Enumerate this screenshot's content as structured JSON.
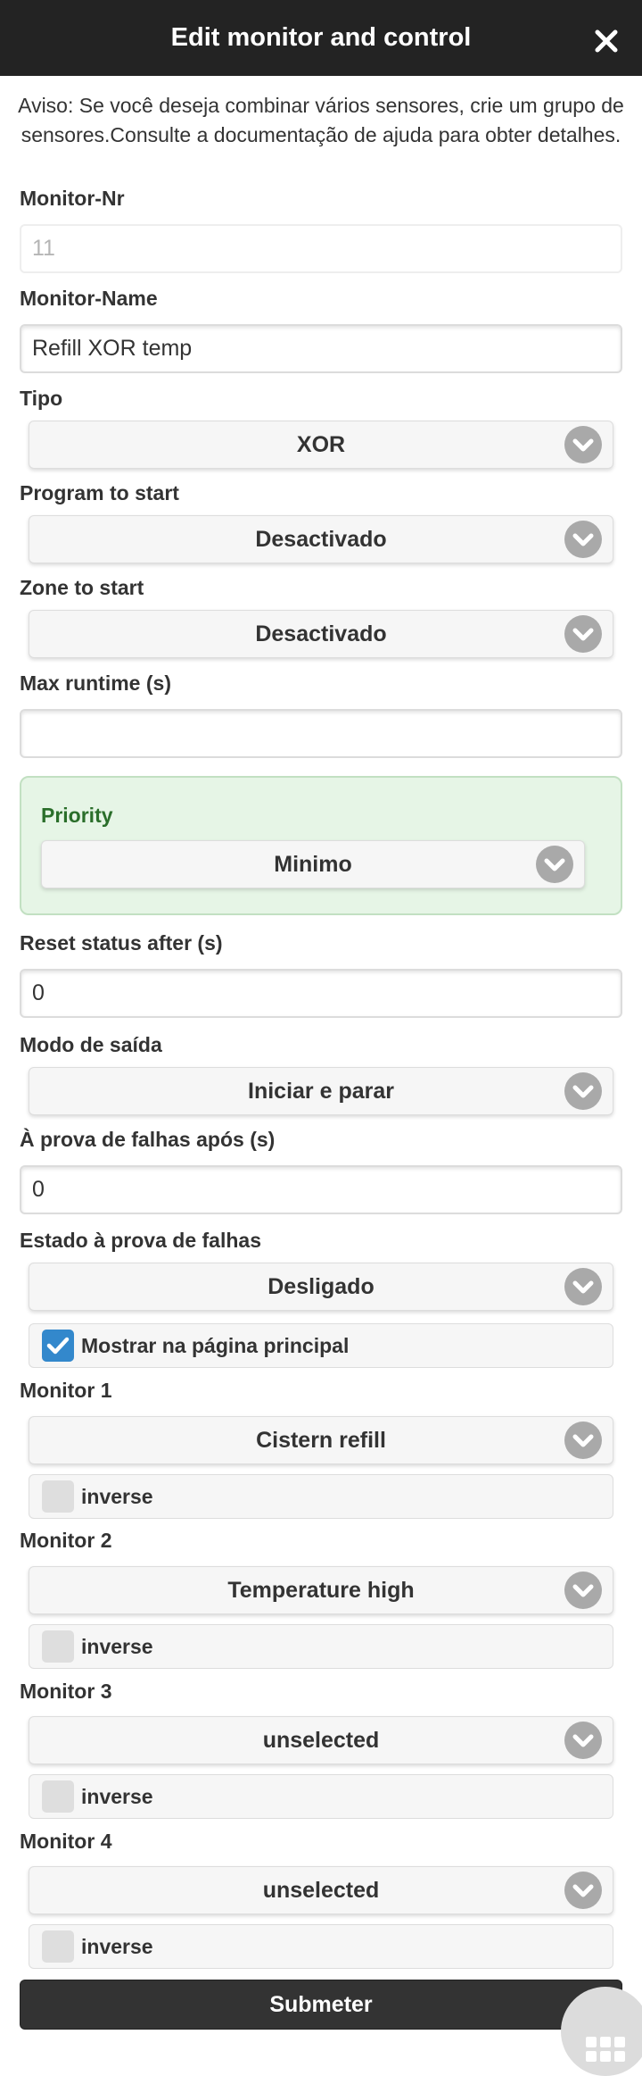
{
  "header": {
    "title": "Edit monitor and control"
  },
  "notice": "Aviso: Se você deseja combinar vários sensores, crie um grupo de sensores.Consulte a documentação de ajuda para obter detalhes.",
  "fields": {
    "monitor_nr": {
      "label": "Monitor-Nr",
      "value": "11"
    },
    "monitor_name": {
      "label": "Monitor-Name",
      "value": "Refill XOR temp"
    },
    "tipo": {
      "label": "Tipo",
      "value": "XOR"
    },
    "program": {
      "label": "Program to start",
      "value": "Desactivado"
    },
    "zone": {
      "label": "Zone to start",
      "value": "Desactivado"
    },
    "max_runtime": {
      "label": "Max runtime (s)",
      "value": ""
    },
    "priority": {
      "label": "Priority",
      "value": "Minimo"
    },
    "reset_status": {
      "label": "Reset status after (s)",
      "value": "0"
    },
    "output_mode": {
      "label": "Modo de saída",
      "value": "Iniciar e parar"
    },
    "failsafe_after": {
      "label": "À prova de falhas após (s)",
      "value": "0"
    },
    "failsafe_state": {
      "label": "Estado à prova de falhas",
      "value": "Desligado"
    },
    "show_main": {
      "label": "Mostrar na página principal",
      "checked": true
    }
  },
  "monitors": [
    {
      "label": "Monitor 1",
      "value": "Cistern refill",
      "inverse_label": "inverse",
      "inverse": false
    },
    {
      "label": "Monitor 2",
      "value": "Temperature high",
      "inverse_label": "inverse",
      "inverse": false
    },
    {
      "label": "Monitor 3",
      "value": "unselected",
      "inverse_label": "inverse",
      "inverse": false
    },
    {
      "label": "Monitor 4",
      "value": "unselected",
      "inverse_label": "inverse",
      "inverse": false
    }
  ],
  "submit_label": "Submeter",
  "icons": {
    "close": "close-icon",
    "dropdown": "chevron-down-icon",
    "check": "check-icon",
    "menu": "grid-menu-icon"
  },
  "colors": {
    "header_bg": "#232323",
    "accent": "#3388cc",
    "priority_bg": "#e6f5e6",
    "priority_label": "#2a6e2a"
  }
}
